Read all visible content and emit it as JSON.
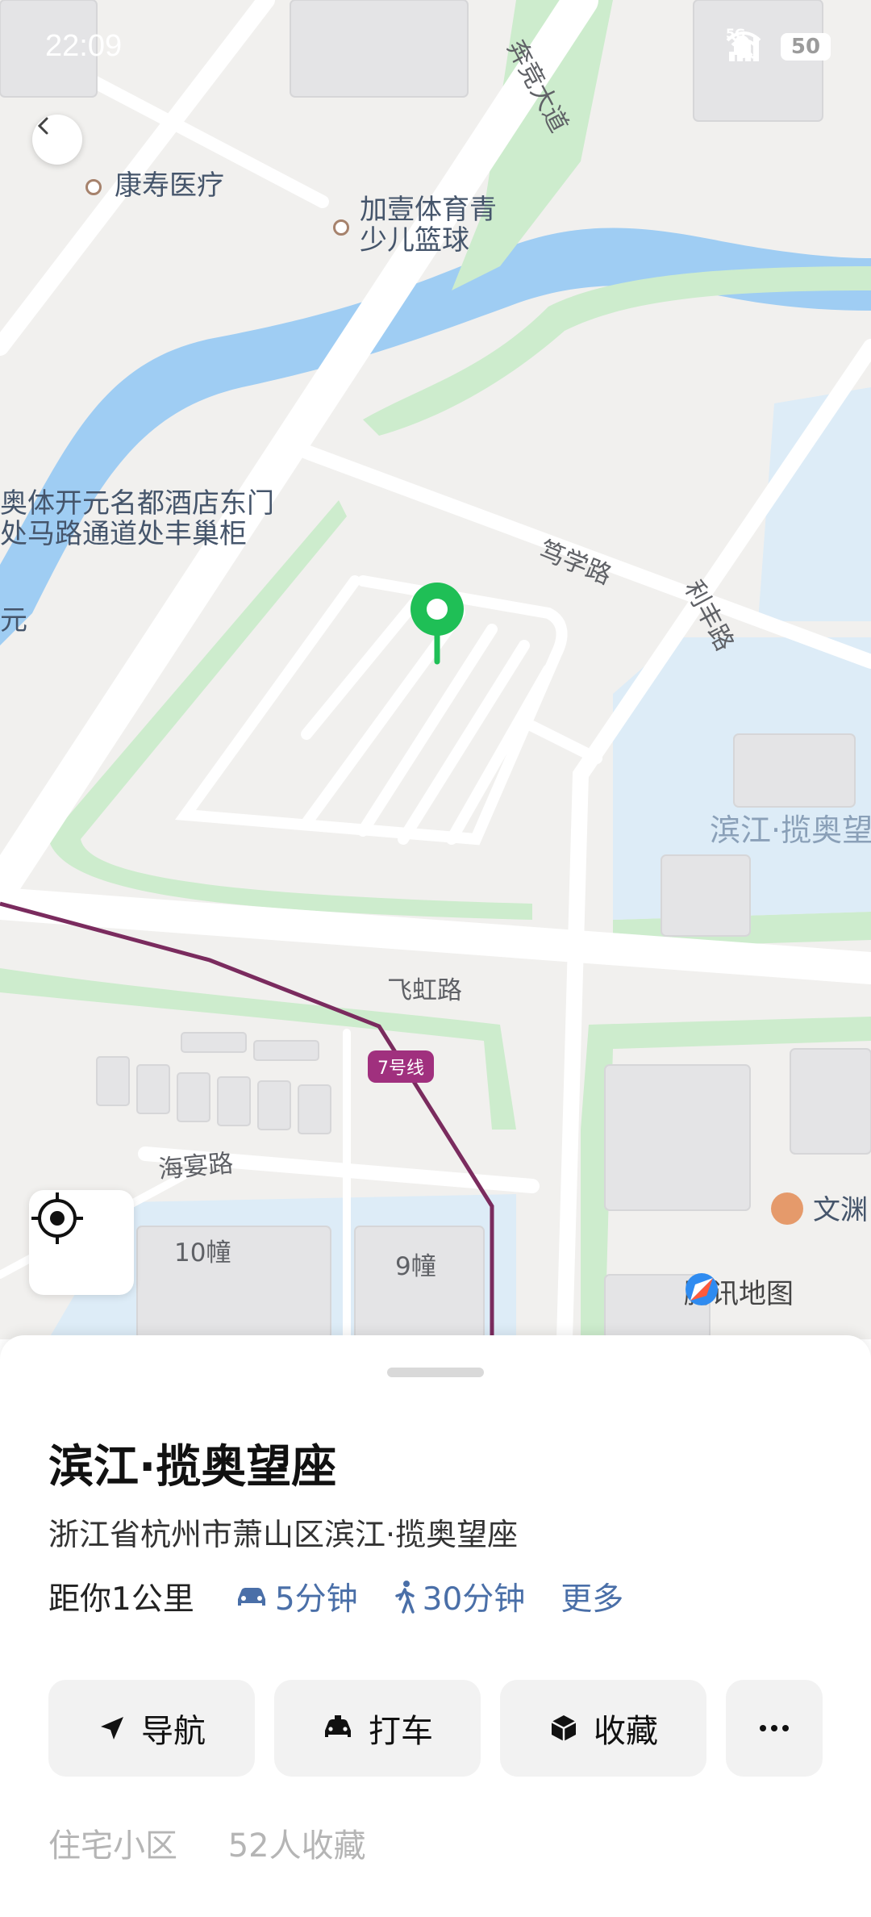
{
  "status_bar": {
    "time": "22:09",
    "network": "5G",
    "battery": "50"
  },
  "map": {
    "pois": [
      {
        "name": "康寿医疗"
      },
      {
        "name_line1": "加壹体育青",
        "name_line2": "少儿篮球"
      },
      {
        "name_line1": "奥体开元名都酒店东门",
        "name_line2": "处马路通道处丰巢柜"
      },
      {
        "name": "文渊"
      }
    ],
    "partial_label": "元",
    "roads": {
      "benjing": "奔竞大道",
      "duxue": "笃学路",
      "lifeng": "利丰路",
      "feihong": "飞虹路",
      "haiyan": "海宴路"
    },
    "area_label": "滨江·揽奥望",
    "buildings": {
      "b10": "10幢",
      "b9": "9幢"
    },
    "metro_line": "7号线",
    "brand": "腾讯地图",
    "colors": {
      "water": "#9fcdf3",
      "green": "#cdeccd",
      "pin": "#1fbf56",
      "metro": "#7a2b5e"
    }
  },
  "place": {
    "title": "滨江·揽奥望座",
    "address": "浙江省杭州市萧山区滨江·揽奥望座",
    "distance": "距你1公里",
    "drive_time": "5分钟",
    "walk_time": "30分钟",
    "more": "更多"
  },
  "actions": {
    "navigate": "导航",
    "taxi": "打车",
    "favorite": "收藏",
    "more_icon": "more-icon"
  },
  "footer": {
    "type": "住宅小区",
    "favorites": "52人收藏"
  }
}
